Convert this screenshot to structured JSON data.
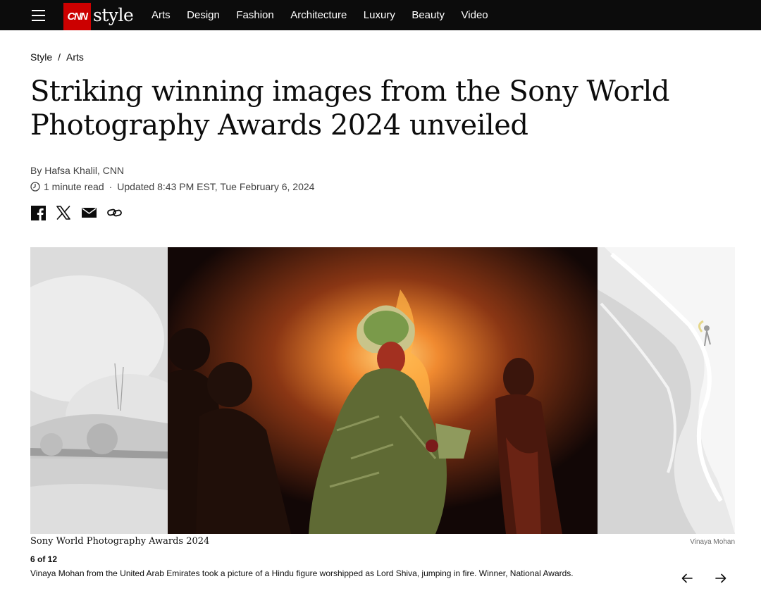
{
  "nav": {
    "logo_mark": "CNN",
    "logo_word": "style",
    "items": [
      "Arts",
      "Design",
      "Fashion",
      "Architecture",
      "Luxury",
      "Beauty",
      "Video"
    ]
  },
  "breadcrumb": {
    "section": "Style",
    "separator": "/",
    "subsection": "Arts"
  },
  "article": {
    "headline": "Striking winning images from the Sony World Photography Awards 2024 unveiled",
    "byline": "By Hafsa Khalil, CNN",
    "read_time": "1 minute read",
    "meta_separator": "·",
    "updated": "Updated 8:43 PM EST, Tue February 6, 2024"
  },
  "share": [
    "facebook-icon",
    "x-icon",
    "email-icon",
    "link-icon"
  ],
  "gallery": {
    "title": "Sony World Photography Awards 2024",
    "credit": "Vinaya Mohan",
    "counter": "6 of 12",
    "caption": "Vinaya Mohan from the United Arab Emirates took a picture of a Hindu figure worshipped as Lord Shiva, jumping in fire. Winner, National Awards."
  },
  "colors": {
    "nav_bg": "#0c0c0c",
    "cnn_red": "#cc0000",
    "text": "#0c0c0c",
    "meta_text": "#404040"
  }
}
